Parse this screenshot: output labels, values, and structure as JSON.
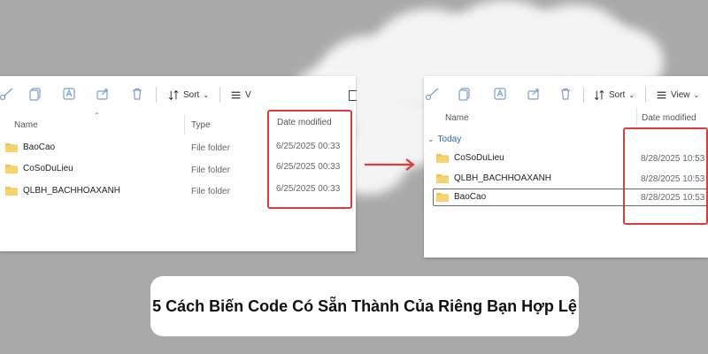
{
  "left_window": {
    "toolbar": {
      "sort_label": "Sort",
      "view_label": "V"
    },
    "columns": {
      "name": "Name",
      "type": "Type",
      "date": "Date modified"
    },
    "rows": [
      {
        "name": "BaoCao",
        "type": "File folder",
        "date": "6/25/2025 00:33"
      },
      {
        "name": "CoSoDuLieu",
        "type": "File folder",
        "date": "6/25/2025 00:33"
      },
      {
        "name": "QLBH_BACHHOAXANH",
        "type": "File folder",
        "date": "6/25/2025 00:33"
      }
    ]
  },
  "right_window": {
    "toolbar": {
      "sort_label": "Sort",
      "view_label": "View"
    },
    "columns": {
      "name": "Name",
      "date": "Date modified"
    },
    "group_label": "Today",
    "rows": [
      {
        "name": "CoSoDuLieu",
        "date": "8/28/2025 10:53"
      },
      {
        "name": "QLBH_BACHHOAXANH",
        "date": "8/28/2025 10:53"
      },
      {
        "name": "BaoCao",
        "date": "8/28/2025 10:53",
        "selected": true
      }
    ]
  },
  "title": "5 Cách Biến Code Có Sẵn Thành Của Riêng Bạn Hợp Lệ",
  "colors": {
    "background": "#a9a9a9",
    "highlight": "#e03a3a",
    "folder": "#f2c14e"
  }
}
